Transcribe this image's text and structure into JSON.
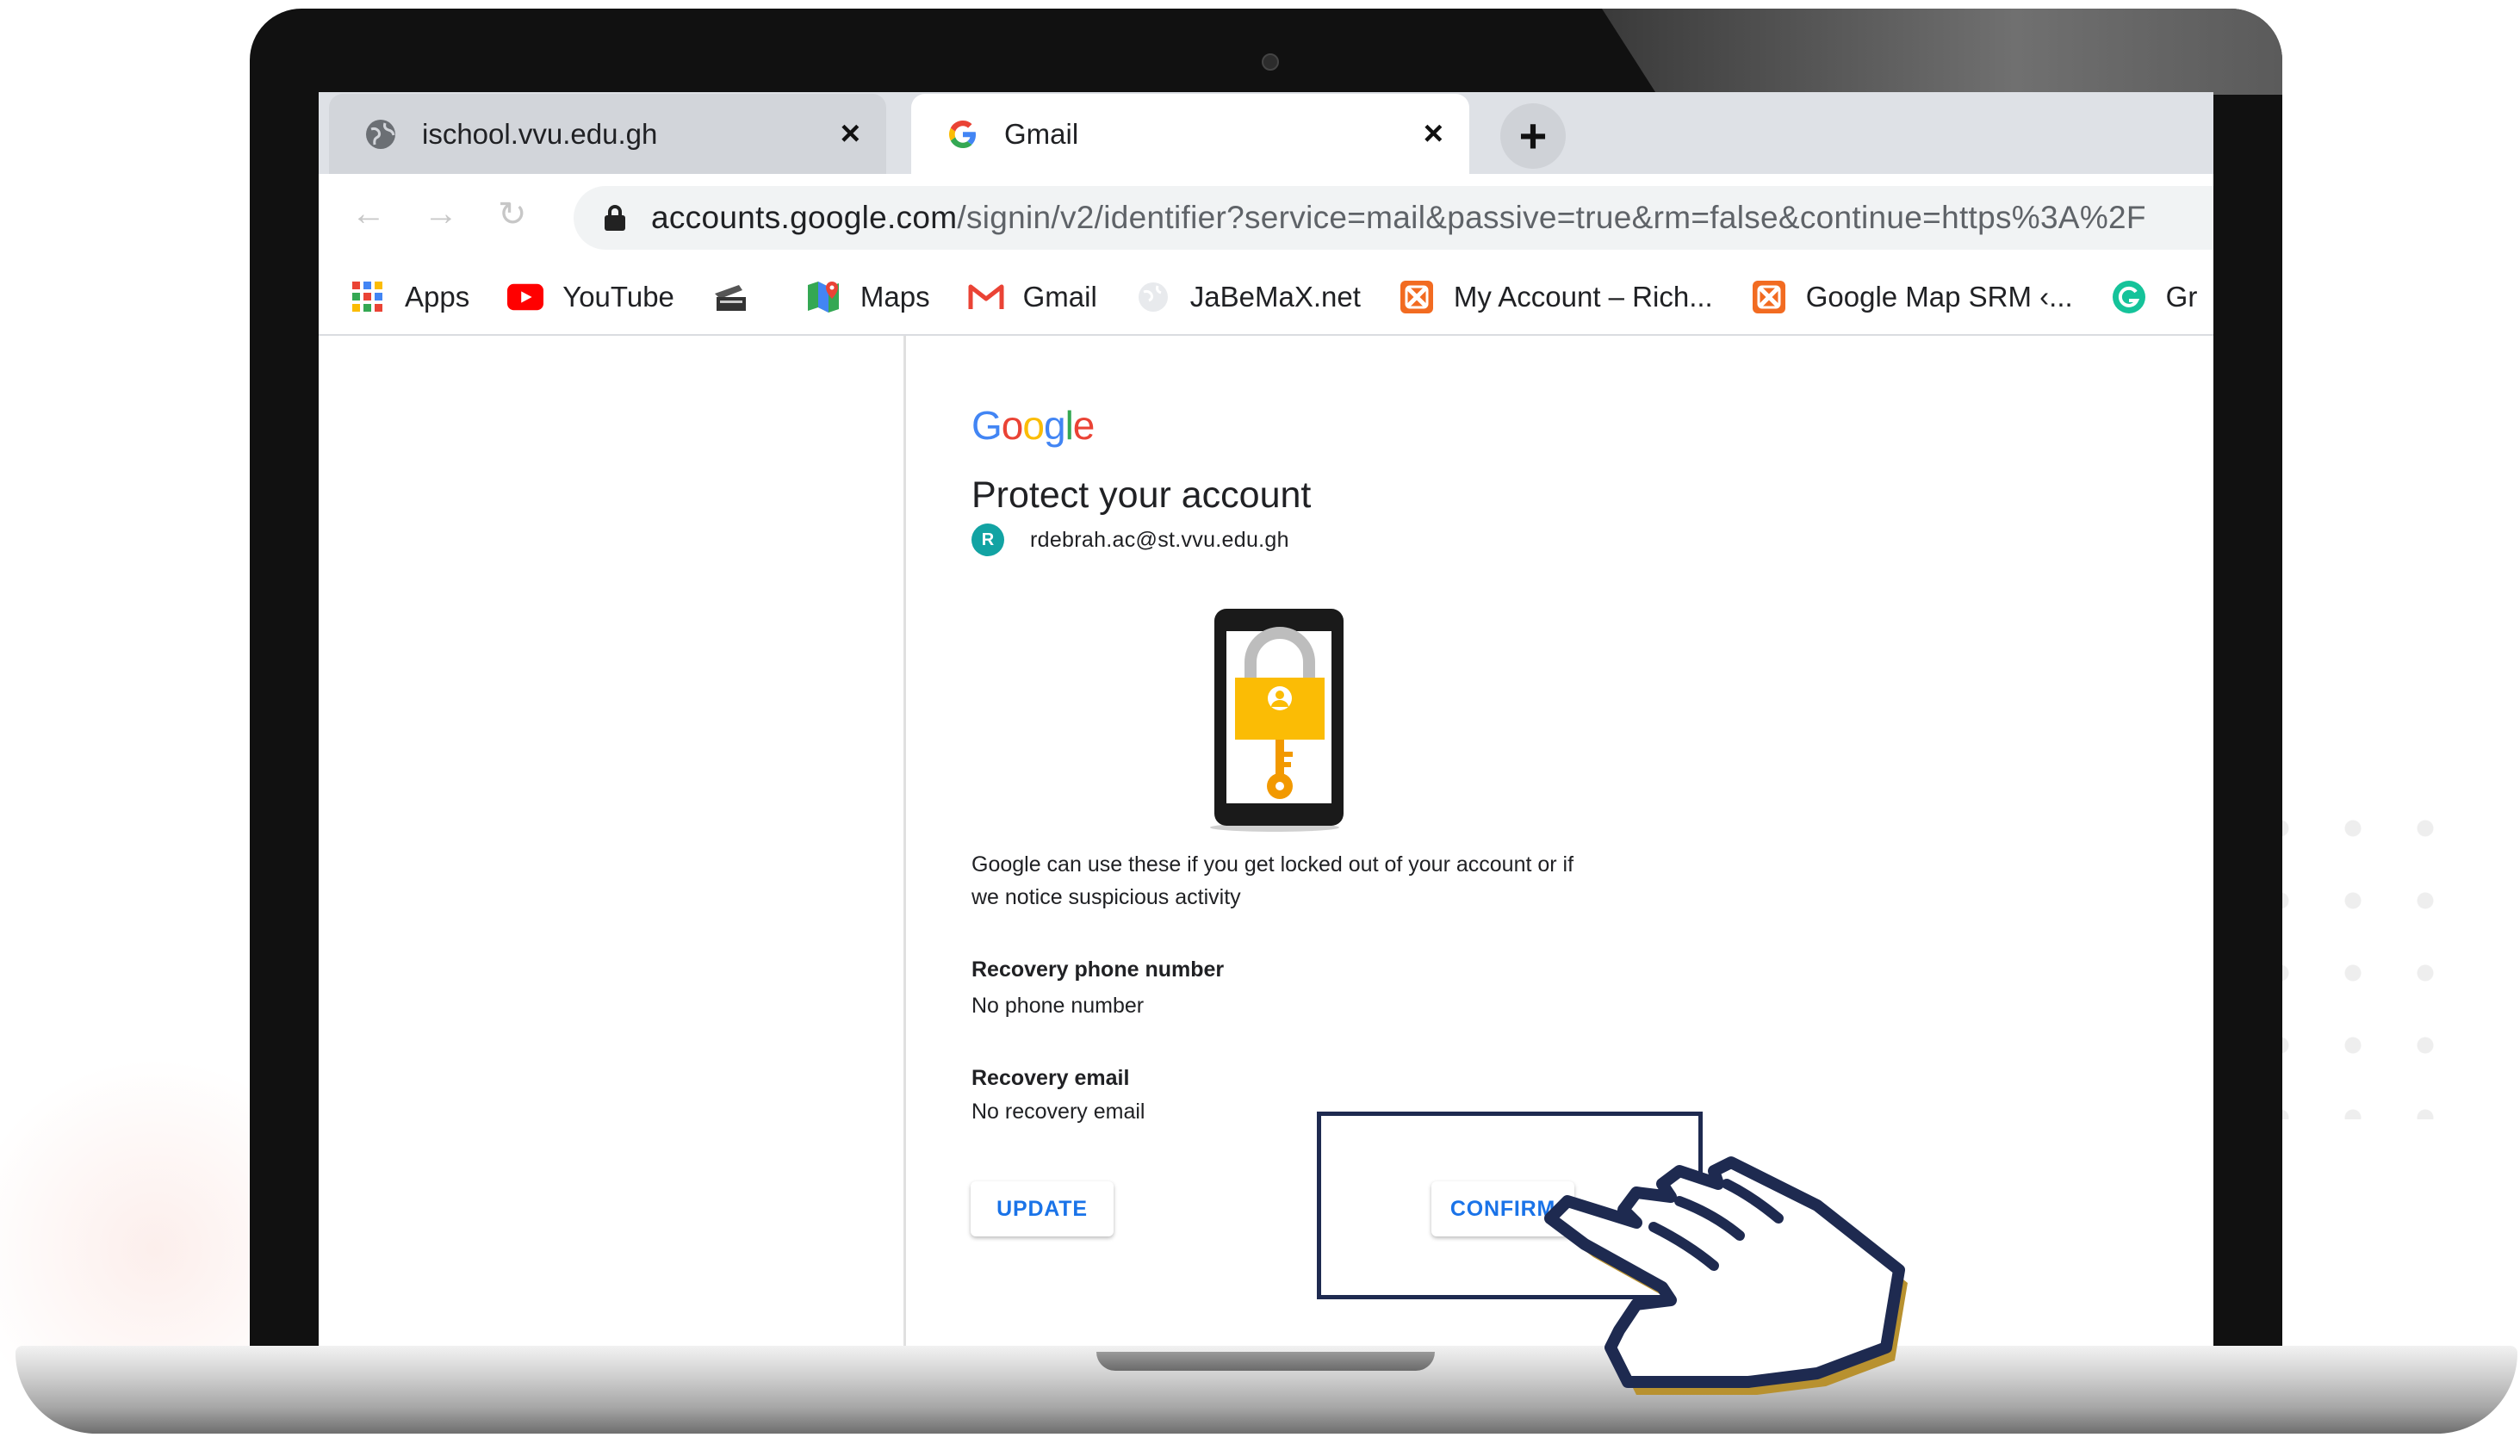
{
  "browser": {
    "tabs": [
      {
        "title": "ischool.vvu.edu.gh",
        "icon": "globe-icon"
      },
      {
        "title": "Gmail",
        "icon": "google-g-icon"
      }
    ],
    "new_tab_label": "+",
    "close_label": "×",
    "url": {
      "host": "accounts.google.com",
      "path": "/signin/v2/identifier?service=mail&passive=true&rm=false&continue=https%3A%2F"
    },
    "bookmarks": [
      {
        "label": "Apps",
        "icon": "apps-grid-icon"
      },
      {
        "label": "YouTube",
        "icon": "youtube-icon"
      },
      {
        "label": "",
        "icon": "folder-icon"
      },
      {
        "label": "Maps",
        "icon": "maps-pin-icon"
      },
      {
        "label": "Gmail",
        "icon": "gmail-icon"
      },
      {
        "label": "JaBeMaX.net",
        "icon": "globe-icon"
      },
      {
        "label": "My Account – Rich...",
        "icon": "xampp-icon"
      },
      {
        "label": "Google Map SRM ‹...",
        "icon": "xampp-icon"
      },
      {
        "label": "Gr",
        "icon": "grammarly-icon"
      }
    ]
  },
  "page": {
    "logo": "Google",
    "heading": "Protect your account",
    "account": {
      "initial": "R",
      "email": "rdebrah.ac@st.vvu.edu.gh"
    },
    "description": "Google can use these if you get locked out of your account or if we notice suspicious activity",
    "recovery_phone": {
      "label": "Recovery phone number",
      "value": "No phone number"
    },
    "recovery_email": {
      "label": "Recovery email",
      "value": "No recovery email"
    },
    "buttons": {
      "update": "UPDATE",
      "confirm": "CONFIRM"
    }
  },
  "colors": {
    "google_blue": "#4285F4",
    "google_red": "#EA4335",
    "google_yellow": "#FBBC05",
    "google_green": "#34A853",
    "link_blue": "#1a73e8",
    "highlight_navy": "#1e2a50",
    "hand_gold": "#b8912f"
  }
}
